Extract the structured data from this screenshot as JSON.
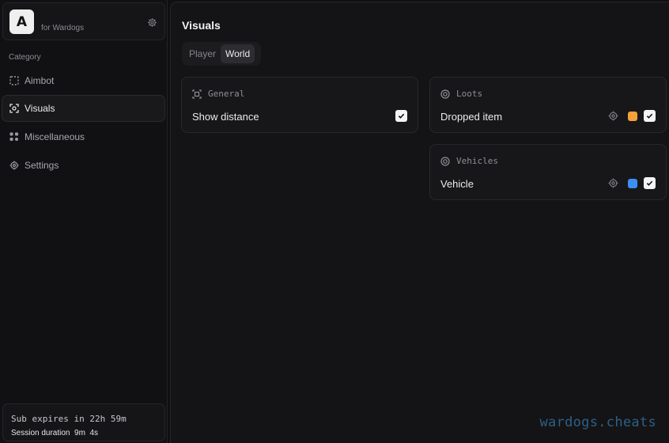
{
  "brand": {
    "logo_letter": "A",
    "subtitle": "for Wardogs"
  },
  "sidebar": {
    "category_label": "Category",
    "items": [
      {
        "label": "Aimbot",
        "icon": "crosshair-frame-icon",
        "active": false
      },
      {
        "label": "Visuals",
        "icon": "eye-scan-icon",
        "active": true
      },
      {
        "label": "Miscellaneous",
        "icon": "grid-dots-icon",
        "active": false
      },
      {
        "label": "Settings",
        "icon": "gear-icon",
        "active": false
      }
    ]
  },
  "subscription": {
    "expires_text": "Sub expires in 22h 59m",
    "session_text": "Session duration  9m  4s"
  },
  "main": {
    "title": "Visuals",
    "tabs": [
      {
        "label": "Player",
        "active": false
      },
      {
        "label": "World",
        "active": true
      }
    ],
    "cards": {
      "general": {
        "header": "General",
        "icon": "crosshair-square-icon",
        "option": {
          "label": "Show distance",
          "checked": true
        }
      },
      "loots": {
        "header": "Loots",
        "icon": "coin-icon",
        "option": {
          "label": "Dropped item",
          "color": "#f5a13a",
          "checked": true
        }
      },
      "vehicles": {
        "header": "Vehicles",
        "icon": "coin-icon",
        "option": {
          "label": "Vehicle",
          "color": "#3d8ef2",
          "checked": true
        }
      }
    }
  },
  "watermark": "wardogs.cheats"
}
